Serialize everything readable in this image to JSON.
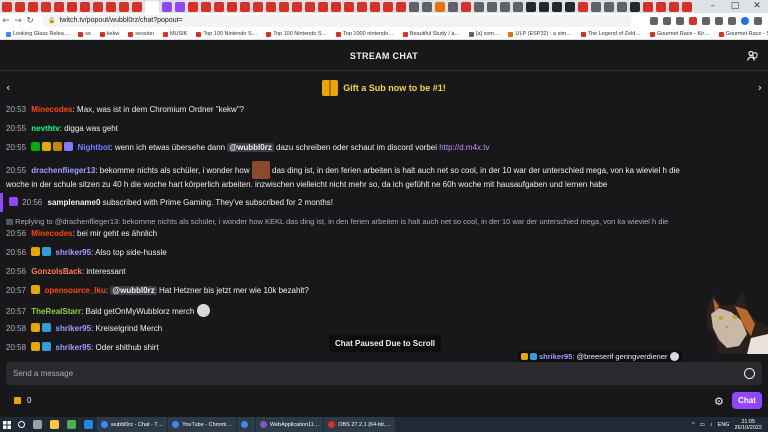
{
  "browser": {
    "tab_colors": [
      "#d93025",
      "#d93025",
      "#d93025",
      "#d93025",
      "#d93025",
      "#d93025",
      "#d93025",
      "#d93025",
      "#d93025",
      "#d93025",
      "#d93025",
      "#ffffff",
      "#9147ff",
      "#9147ff",
      "#d93025",
      "#d93025",
      "#d93025",
      "#d93025",
      "#d93025",
      "#d93025",
      "#d93025",
      "#d93025",
      "#d93025",
      "#d93025",
      "#d93025",
      "#d93025",
      "#d93025",
      "#d93025",
      "#d93025",
      "#d93025",
      "#d93025",
      "#5f6368",
      "#5f6368",
      "#e8710a",
      "#5f6368",
      "#d93025",
      "#5f6368",
      "#5f6368",
      "#5f6368",
      "#5f6368",
      "#24292f",
      "#24292f",
      "#24292f",
      "#24292f",
      "#d93025",
      "#5f6368",
      "#5f6368",
      "#5f6368",
      "#24292f",
      "#d93025",
      "#d93025",
      "#d93025",
      "#d93025"
    ],
    "url": "twitch.tv/popout/wubbl0rz/chat?popout=",
    "bookmarks": [
      {
        "label": "Looking Glass Relea…",
        "color": "#4285f4"
      },
      {
        "label": "ss",
        "color": "#d93025"
      },
      {
        "label": "kekw",
        "color": "#d93025"
      },
      {
        "label": "session",
        "color": "#d93025"
      },
      {
        "label": "MUSIK",
        "color": "#d93025"
      },
      {
        "label": "Top 100 Nintendo S…",
        "color": "#d93025"
      },
      {
        "label": "Top 100 Nintendo S…",
        "color": "#d93025"
      },
      {
        "label": "Top 1000 nintendo…",
        "color": "#d93025"
      },
      {
        "label": "Beautiful Study / a…",
        "color": "#d93025"
      },
      {
        "label": "[a] som…",
        "color": "#5f6368"
      },
      {
        "label": "ULP (ESP32) : a sim…",
        "color": "#e8710a"
      },
      {
        "label": "The Legend of Zeld…",
        "color": "#d93025"
      },
      {
        "label": "Gourmet Race - Kir…",
        "color": "#d93025"
      },
      {
        "label": "Gourmet Race - Su…",
        "color": "#d93025"
      },
      {
        "label": "gachibass gif - Goo…",
        "color": "#4285f4"
      }
    ]
  },
  "header": {
    "title": "STREAM CHAT"
  },
  "banner": {
    "text": "Gift a Sub now to be #1!"
  },
  "messages": [
    {
      "ts": "20:53",
      "user": "Minecodes",
      "color": "#ff4500",
      "text": ": Max, was ist in dem Chromium Ordner \"kekw\"?"
    },
    {
      "ts": "20:55",
      "user": "nevthtv",
      "color": "#00ff7f",
      "text": ": digga was geht"
    },
    {
      "ts": "20:55",
      "user": "Nightbot",
      "color": "#7c7cff",
      "pre": ": wenn ich etwas übersehe dann ",
      "mention": "@wubbl0rz",
      "post": " dazu schreiben oder schaut im discord vorbei ",
      "link": "http://d.m4x.tv"
    },
    {
      "ts": "20:55",
      "user": "drachenflieger13",
      "color": "#9e9eff",
      "pre": ": bekomme nichts als schüler, i wonder how ",
      "post": " das ding ist, in den ferien arbeiten is halt auch net so cool, in der 10 war der unterschied mega, von ka wieviel h die",
      "line2": "woche in der schule sitzen zu 40 h die woche hart körperlich arbeiten. inzwischen vielleicht nicht mehr so, da ich gefühlt ne 60h woche mit hausaufgaben und lernen habe"
    },
    {
      "ts": "20:56",
      "user": "samplename0",
      "text": " subscribed with Prime Gaming. They've subscribed for 2 months!"
    },
    {
      "reply": "Replying to @drachenflieger13: bekomme nichts als schüler, i wonder how KEKL das ding ist, in den ferien arbeiten is halt auch net so cool, in der 10 war der unterschied mega, von ka wieviel h die"
    },
    {
      "ts": "20:56",
      "user": "Minecodes",
      "color": "#ff4500",
      "text": ": bei mir geht es ähnlich"
    },
    {
      "ts": "20:56",
      "user": "shriker95",
      "color": "#9e9eff",
      "text": ": Also top side-hussle"
    },
    {
      "ts": "20:56",
      "user": "GonzolsBack",
      "color": "#ff7f50",
      "text": ": interessant"
    },
    {
      "ts": "20:57",
      "user": "opensource_lku",
      "color": "#ff4500",
      "pre": ": ",
      "mention": "@wubbl0rz",
      "post": " Hat Hetzner bis jetzt mer wie 10k bezahlt?"
    },
    {
      "ts": "20:57",
      "user": "TheRealStarr",
      "color": "#9acd32",
      "text": ": Bald getOnMyWubblorz merch"
    },
    {
      "ts": "20:58",
      "user": "shriker95",
      "color": "#9e9eff",
      "text": ": Kreiselgrind Merch"
    },
    {
      "ts": "20:58",
      "user": "shriker95",
      "color": "#9e9eff",
      "text": ": Oder shithub shirt"
    }
  ],
  "paused_label": "Chat Paused Due to Scroll",
  "overlay": {
    "user": "shriker95",
    "text": ": @breeserif geringverdiener"
  },
  "input": {
    "placeholder": "Send a message"
  },
  "points": {
    "value": "0"
  },
  "chat_button": "Chat",
  "taskbar": {
    "apps": [
      {
        "label": "wubbl0rz - Chat - T…",
        "color": "#4285f4"
      },
      {
        "label": "YouTube - Chromi…",
        "color": "#4285f4"
      },
      {
        "label": "",
        "color": "#4285f4"
      },
      {
        "label": "WebApplication11…",
        "color": "#7e57c2"
      },
      {
        "label": "OBS 27.2.1 (64-bit,…",
        "color": "#d93025"
      }
    ],
    "lang": "ENG",
    "time": "21:05",
    "date": "26/10/2022"
  }
}
